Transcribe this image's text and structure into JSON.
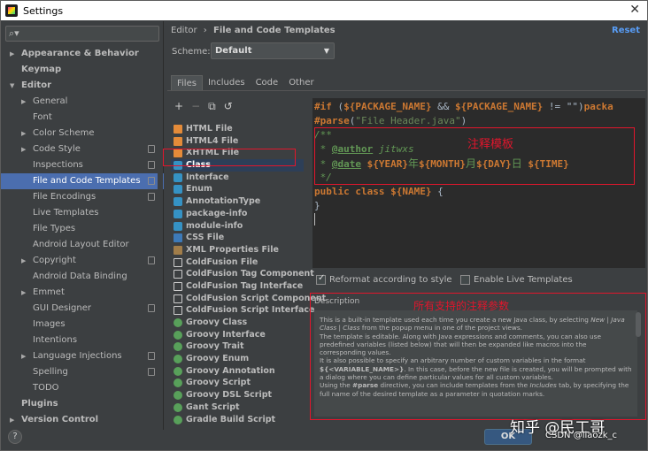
{
  "window": {
    "title": "Settings",
    "close": "✕"
  },
  "search": {
    "icon": "search-icon",
    "placeholder": ""
  },
  "sidebar": {
    "items": [
      {
        "label": "Appearance & Behavior",
        "level": 0,
        "bold": true,
        "arrow": "▶"
      },
      {
        "label": "Keymap",
        "level": 0,
        "bold": true,
        "arrow": ""
      },
      {
        "label": "Editor",
        "level": 0,
        "bold": true,
        "arrow": "▼"
      },
      {
        "label": "General",
        "level": 1,
        "arrow": "▶"
      },
      {
        "label": "Font",
        "level": 1,
        "arrow": ""
      },
      {
        "label": "Color Scheme",
        "level": 1,
        "arrow": "▶"
      },
      {
        "label": "Code Style",
        "level": 1,
        "arrow": "▶",
        "page_icon": true
      },
      {
        "label": "Inspections",
        "level": 1,
        "arrow": "",
        "page_icon": true
      },
      {
        "label": "File and Code Templates",
        "level": 1,
        "arrow": "",
        "page_icon": true,
        "selected": true
      },
      {
        "label": "File Encodings",
        "level": 1,
        "arrow": "",
        "page_icon": true
      },
      {
        "label": "Live Templates",
        "level": 1,
        "arrow": ""
      },
      {
        "label": "File Types",
        "level": 1,
        "arrow": ""
      },
      {
        "label": "Android Layout Editor",
        "level": 1,
        "arrow": ""
      },
      {
        "label": "Copyright",
        "level": 1,
        "arrow": "▶",
        "page_icon": true
      },
      {
        "label": "Android Data Binding",
        "level": 1,
        "arrow": ""
      },
      {
        "label": "Emmet",
        "level": 1,
        "arrow": "▶"
      },
      {
        "label": "GUI Designer",
        "level": 1,
        "arrow": "",
        "page_icon": true
      },
      {
        "label": "Images",
        "level": 1,
        "arrow": ""
      },
      {
        "label": "Intentions",
        "level": 1,
        "arrow": ""
      },
      {
        "label": "Language Injections",
        "level": 1,
        "arrow": "▶",
        "page_icon": true
      },
      {
        "label": "Spelling",
        "level": 1,
        "arrow": "",
        "page_icon": true
      },
      {
        "label": "TODO",
        "level": 1,
        "arrow": ""
      },
      {
        "label": "Plugins",
        "level": 0,
        "bold": true,
        "arrow": ""
      },
      {
        "label": "Version Control",
        "level": 0,
        "bold": true,
        "arrow": "▶"
      }
    ]
  },
  "breadcrumb": {
    "part1": "Editor",
    "sep": "›",
    "part2": "File and Code Templates"
  },
  "reset_label": "Reset",
  "scheme": {
    "label": "Scheme:",
    "value": "Default"
  },
  "tabs": [
    "Files",
    "Includes",
    "Code",
    "Other"
  ],
  "toolbar": {
    "add": "+",
    "remove": "−",
    "copy": "⧉",
    "revert": "↺"
  },
  "file_templates": [
    {
      "name": "HTML File",
      "icon": "html"
    },
    {
      "name": "HTML4 File",
      "icon": "html"
    },
    {
      "name": "XHTML File",
      "icon": "html"
    },
    {
      "name": "Class",
      "icon": "java",
      "selected": true
    },
    {
      "name": "Interface",
      "icon": "java"
    },
    {
      "name": "Enum",
      "icon": "java"
    },
    {
      "name": "AnnotationType",
      "icon": "java"
    },
    {
      "name": "package-info",
      "icon": "java"
    },
    {
      "name": "module-info",
      "icon": "java"
    },
    {
      "name": "CSS File",
      "icon": "css"
    },
    {
      "name": "XML Properties File",
      "icon": "xml"
    },
    {
      "name": "ColdFusion File",
      "icon": "cf"
    },
    {
      "name": "ColdFusion Tag Component",
      "icon": "cf"
    },
    {
      "name": "ColdFusion Tag Interface",
      "icon": "cf"
    },
    {
      "name": "ColdFusion Script Component",
      "icon": "cf"
    },
    {
      "name": "ColdFusion Script Interface",
      "icon": "cf"
    },
    {
      "name": "Groovy Class",
      "icon": "groovy"
    },
    {
      "name": "Groovy Interface",
      "icon": "groovy"
    },
    {
      "name": "Groovy Trait",
      "icon": "groovy"
    },
    {
      "name": "Groovy Enum",
      "icon": "groovy"
    },
    {
      "name": "Groovy Annotation",
      "icon": "groovy"
    },
    {
      "name": "Groovy Script",
      "icon": "groovy"
    },
    {
      "name": "Groovy DSL Script",
      "icon": "groovy"
    },
    {
      "name": "Gant Script",
      "icon": "groovy"
    },
    {
      "name": "Gradle Build Script",
      "icon": "groovy"
    }
  ],
  "code": {
    "line1": {
      "kw": "#if",
      "open": " (",
      "v1": "${PACKAGE_NAME}",
      "and": " && ",
      "v2": "${PACKAGE_NAME}",
      "ne": " != \"\")",
      "tail": "packa"
    },
    "line2": {
      "kw": "#parse",
      "open": "(",
      "str": "\"File Header.java\"",
      "close": ")"
    },
    "line3": "/**",
    "line4": {
      "star": " * ",
      "tag": "@author",
      "val": " jitwxs"
    },
    "line5": {
      "star": " * ",
      "tag": "@date",
      "sp": " ",
      "y": "${YEAR}",
      "c1": "年",
      "m": "${MONTH}",
      "c2": "月",
      "d": "${DAY}",
      "c3": "日",
      "sp2": " ",
      "t": "${TIME}"
    },
    "line6": " */",
    "line7": {
      "kw1": "public",
      "kw2": " class ",
      "name": "${NAME}",
      "brace": " {"
    },
    "line8": "}"
  },
  "annotations": {
    "comment_template": "注释模板",
    "supported_params": "所有支持的注释参数"
  },
  "options": {
    "reformat": "Reformat according to style",
    "reformat_checked": true,
    "live": "Enable Live Templates",
    "live_checked": false
  },
  "description": {
    "title": "Description",
    "p1a": "This is a built-in template used each time you create a new Java class, by selecting ",
    "p1b": "New | Java Class | Class",
    "p1c": " from the popup menu in one of the project views.",
    "p2": "The template is editable. Along with Java expressions and comments, you can also use predefined variables (listed below) that will then be expanded like macros into the corresponding values.",
    "p3a": "It is also possible to specify an arbitrary number of custom variables in the format ",
    "p3b": "${<VARIABLE_NAME>}",
    "p3c": ". In this case, before the new file is created, you will be prompted with a dialog where you can define particular values for all custom variables.",
    "p4a": "Using the ",
    "p4b": "#parse",
    "p4c": " directive, you can include templates from the ",
    "p4d": "Includes",
    "p4e": " tab, by specifying the full name of the desired template as a parameter in quotation marks."
  },
  "buttons": {
    "ok": "OK",
    "help": "?"
  },
  "watermark": {
    "line1": "知乎 @民工哥",
    "line2": "CSDN @liaozk_c"
  }
}
